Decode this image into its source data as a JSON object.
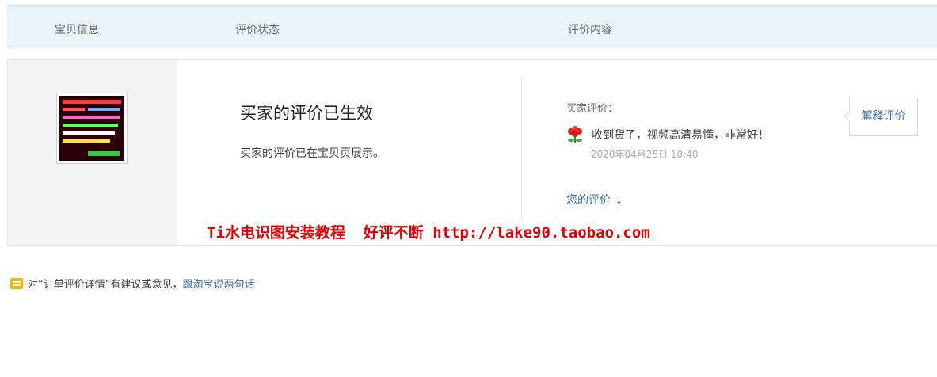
{
  "table_header": {
    "col_item": "宝贝信息",
    "col_status": "评价状态",
    "col_content": "评价内容"
  },
  "item": {
    "thumbnail_icon": "product-thumbnail-image"
  },
  "status": {
    "title": "买家的评价已生效",
    "description": "买家的评价已在宝贝页展示。"
  },
  "review": {
    "label": "买家评价：",
    "rating_icon": "red-flower-icon",
    "text": "收到货了，视频高清易懂，非常好！",
    "time": "2020年04月25日 10:40",
    "your_review_label": "您的评价",
    "explain_button": "解释评价"
  },
  "watermark_text": "Ti水电识图安装教程  好评不断 http://lake90.taobao.com",
  "feedback": {
    "prefix": "对“订单评价详情”有建议或意见，",
    "link": "跟淘宝说两句话"
  },
  "colors": {
    "header_bg": "#ebf3fb",
    "link": "#3a6ea5",
    "watermark": "#e00000"
  }
}
